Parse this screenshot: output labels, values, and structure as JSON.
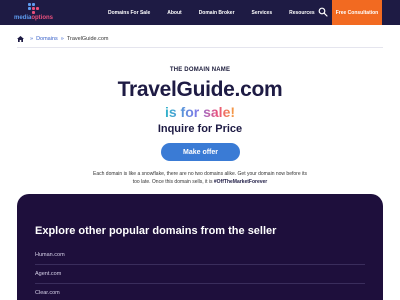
{
  "header": {
    "logo_text_left": "media",
    "logo_text_right": "options",
    "nav_items": [
      "Domains For Sale",
      "About",
      "Domain Broker",
      "Services",
      "Resources"
    ],
    "cta_label": "Free Consultation",
    "search_icon": "search-icon"
  },
  "breadcrumb": {
    "home_icon": "home-icon",
    "items": [
      "Domains",
      "TravelGuide.com"
    ]
  },
  "hero": {
    "eyebrow": "THE DOMAIN NAME",
    "domain": "TravelGuide.com",
    "for_sale": "is for sale!",
    "inquire": "Inquire for Price",
    "offer_button": "Make offer",
    "blurb_text": "Each domain is like a snowflake, there are no two domains alike. Get your domain now before its too late. Once this domain sells, it is ",
    "blurb_hashtag": "#OffTheMarketForever"
  },
  "popular": {
    "title": "Explore other popular domains from the seller",
    "domains": [
      "Human.com",
      "Agent.com",
      "Clear.com"
    ]
  },
  "colors": {
    "nav_bg": "#1e1b44",
    "cta_bg": "#f26a21",
    "button_blue": "#3a7bd5",
    "panel_bg": "#1e0f3c"
  }
}
